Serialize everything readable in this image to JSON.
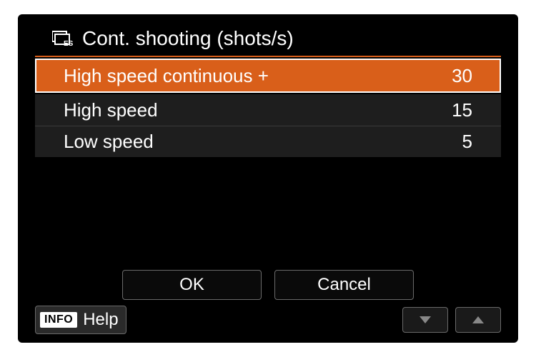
{
  "header": {
    "icon_name": "continuous-shooting-es-icon",
    "title": "Cont. shooting (shots/s)"
  },
  "rows": [
    {
      "label": "High speed continuous +",
      "value": "30",
      "selected": true
    },
    {
      "label": "High speed",
      "value": "15",
      "selected": false
    },
    {
      "label": "Low speed",
      "value": "5",
      "selected": false
    }
  ],
  "footer": {
    "ok_label": "OK",
    "cancel_label": "Cancel"
  },
  "bottom": {
    "info_badge": "INFO",
    "help_label": "Help"
  },
  "colors": {
    "accent": "#d95f1a",
    "bg": "#000000",
    "row_bg": "#1e1e1e",
    "text": "#ffffff"
  }
}
